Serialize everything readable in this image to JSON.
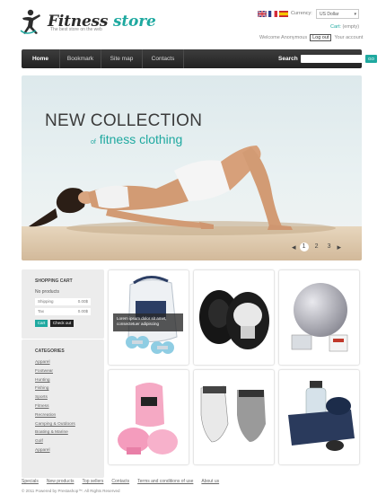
{
  "header": {
    "logo_main": "Fitness",
    "logo_accent": "store",
    "tagline": "The best store on the web",
    "flags": [
      "flag-uk-icon",
      "flag-fr-icon",
      "flag-es-icon"
    ],
    "currency_label": "Currency:",
    "currency_value": "US Dollar",
    "cart_label": "Cart:",
    "cart_status": "(empty)",
    "welcome_text": "Welcome Anonymous",
    "logout_label": "Log out",
    "account_label": "Your account"
  },
  "nav": {
    "items": [
      {
        "label": "Home"
      },
      {
        "label": "Bookmark"
      },
      {
        "label": "Site map"
      },
      {
        "label": "Contacts"
      }
    ],
    "search_label": "Search",
    "search_placeholder": "",
    "search_button": "GO"
  },
  "banner": {
    "title": "NEW COLLECTION",
    "sub_of": "of",
    "sub_main": "fitness clothing",
    "pages": [
      "1",
      "2",
      "3"
    ],
    "active_page": "1"
  },
  "cart_box": {
    "title": "SHOPPING CART",
    "no_products": "No products",
    "shipping_label": "Shipping",
    "shipping_value": "0.00$",
    "tax_label": "Tax",
    "tax_value": "0.00$",
    "total_label": "Total",
    "total_value": "0.00$",
    "cart_button": "Cart",
    "checkout_button": "Check out"
  },
  "categories": {
    "title": "CATEGORIES",
    "items": [
      "Apparel",
      "Footwear",
      "Hunting",
      "Fishing",
      "Sports",
      "Fitness",
      "Recreation",
      "Camping & Outdoors",
      "Boating & Marine",
      "Golf",
      "Apparel"
    ]
  },
  "products": {
    "overlay_text": "Lorem ipsum dolor sit amet, consectetuer adipiscing"
  },
  "footer": {
    "links": [
      "Specials",
      "New products",
      "Top sellers",
      "Contacts",
      "Terms and conditions of use",
      "About us"
    ],
    "copyright": "© 2011 Powered by Prestashop™. All Rights Reserved"
  },
  "colors": {
    "accent": "#1fa9a0",
    "nav_dark": "#2a2a2a"
  }
}
